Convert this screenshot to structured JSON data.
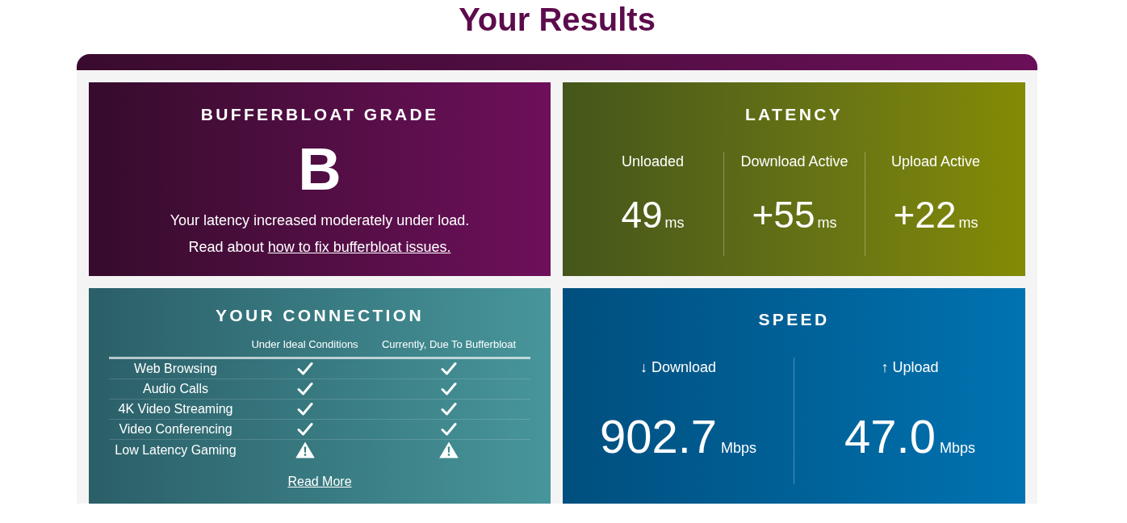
{
  "page_title": "Your Results",
  "grade_card": {
    "title": "BUFFERBLOAT GRADE",
    "grade": "B",
    "summary": "Your latency increased moderately under load.",
    "fix_prefix": "Read about",
    "fix_link": "how to fix bufferbloat issues."
  },
  "latency_card": {
    "title": "LATENCY",
    "metrics": [
      {
        "label": "Unloaded",
        "value": "49",
        "unit": "ms"
      },
      {
        "label": "Download Active",
        "value": "+55",
        "unit": "ms"
      },
      {
        "label": "Upload Active",
        "value": "+22",
        "unit": "ms"
      }
    ]
  },
  "connection_card": {
    "title": "YOUR CONNECTION",
    "columns": [
      "Under Ideal Conditions",
      "Currently, Due To Bufferbloat"
    ],
    "rows": [
      {
        "activity": "Web Browsing",
        "statuses": [
          {
            "kind": "check"
          },
          {
            "kind": "check"
          }
        ]
      },
      {
        "activity": "Audio Calls",
        "statuses": [
          {
            "kind": "check"
          },
          {
            "kind": "check"
          }
        ]
      },
      {
        "activity": "4K Video Streaming",
        "statuses": [
          {
            "kind": "check"
          },
          {
            "kind": "check"
          }
        ]
      },
      {
        "activity": "Video Conferencing",
        "statuses": [
          {
            "kind": "check"
          },
          {
            "kind": "check"
          }
        ]
      },
      {
        "activity": "Low Latency Gaming",
        "statuses": [
          {
            "kind": "warning"
          },
          {
            "kind": "warning"
          }
        ]
      }
    ],
    "read_more": "Read More"
  },
  "speed_card": {
    "title": "SPEED",
    "metrics": [
      {
        "label": "↓ Download",
        "value": "902.7",
        "unit": "Mbps"
      },
      {
        "label": "↑ Upload",
        "value": "47.0",
        "unit": "Mbps"
      }
    ]
  }
}
